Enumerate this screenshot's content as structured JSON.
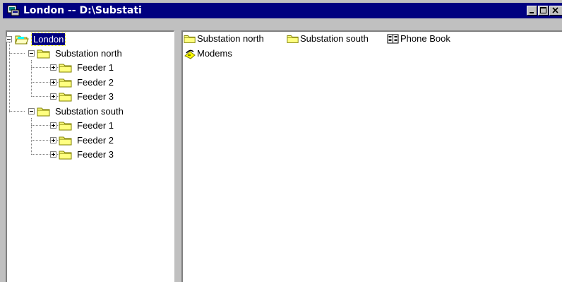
{
  "window": {
    "title": "London -- D:\\Substati",
    "minimize_icon": "minimize-icon",
    "maximize_icon": "maximize-icon",
    "close_icon": "close-icon"
  },
  "tree": {
    "root": {
      "label": "London",
      "selected": true,
      "icon": "open-folder-icon"
    },
    "stations": [
      {
        "label": "Substation north",
        "icon": "folder-icon",
        "feeders": [
          {
            "label": "Feeder 1"
          },
          {
            "label": "Feeder 2"
          },
          {
            "label": "Feeder 3"
          }
        ]
      },
      {
        "label": "Substation south",
        "icon": "folder-icon",
        "feeders": [
          {
            "label": "Feeder 1"
          },
          {
            "label": "Feeder 2"
          },
          {
            "label": "Feeder 3"
          }
        ]
      }
    ]
  },
  "list": {
    "items": [
      {
        "label": "Substation north",
        "icon": "folder-icon"
      },
      {
        "label": "Substation south",
        "icon": "folder-icon"
      },
      {
        "label": "Phone Book",
        "icon": "phone-book-icon"
      },
      {
        "label": "Modems",
        "icon": "modem-icon"
      }
    ]
  },
  "colors": {
    "titlebar": "#000080",
    "face": "#c0c0c0",
    "folder": "#ffff80",
    "selection": "#000080"
  }
}
